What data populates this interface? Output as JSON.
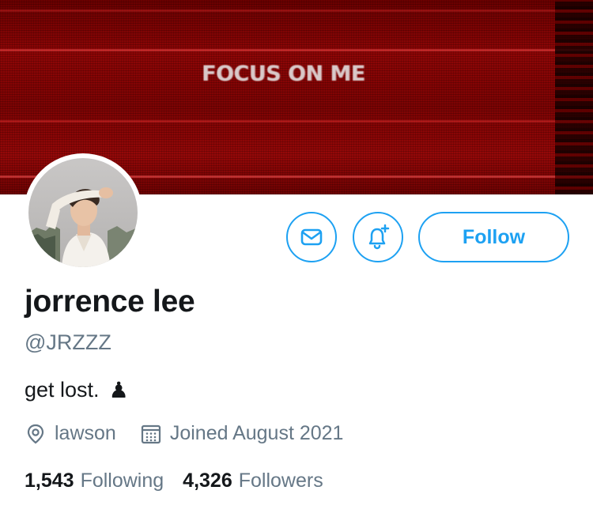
{
  "banner": {
    "text": "FOCUS ON ME",
    "colors": {
      "base": "#8f0606",
      "dark": "#6a0000"
    }
  },
  "profile": {
    "name": "jorrence lee",
    "handle": "@JRZZZ",
    "bio": "get lost.",
    "bio_emoji": "♟",
    "location": "lawson",
    "joined": "Joined August 2021"
  },
  "actions": {
    "message_icon": "envelope-icon",
    "notify_icon": "bell-plus-icon",
    "follow_label": "Follow"
  },
  "stats": {
    "following_count": "1,543",
    "following_label": "Following",
    "followers_count": "4,326",
    "followers_label": "Followers"
  },
  "colors": {
    "accent": "#1da1f2",
    "text_primary": "#14171a",
    "text_secondary": "#657786"
  }
}
